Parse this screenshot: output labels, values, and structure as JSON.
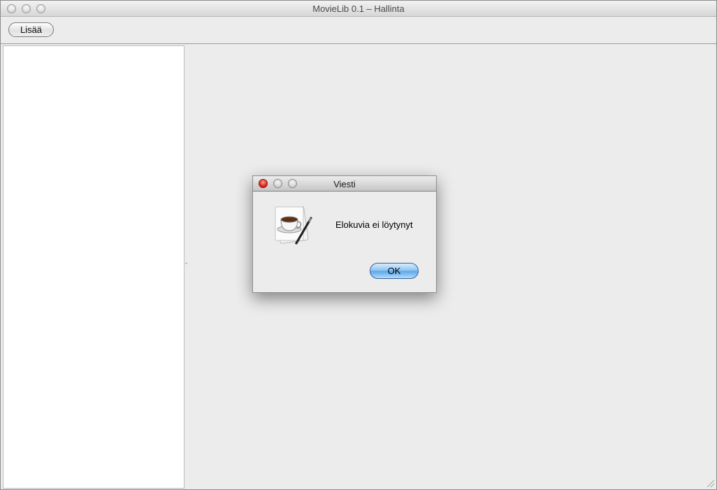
{
  "window": {
    "title": "MovieLib 0.1 – Hallinta"
  },
  "toolbar": {
    "add_label": "Lisää"
  },
  "dialog": {
    "title": "Viesti",
    "message": "Elokuvia ei löytynyt",
    "ok_label": "OK",
    "icon": "java-coffee-cup-icon"
  },
  "colors": {
    "window_bg": "#ececec",
    "panel_bg": "#ffffff",
    "close_button": "#d81f12",
    "ok_button": "#8bc3f3"
  }
}
